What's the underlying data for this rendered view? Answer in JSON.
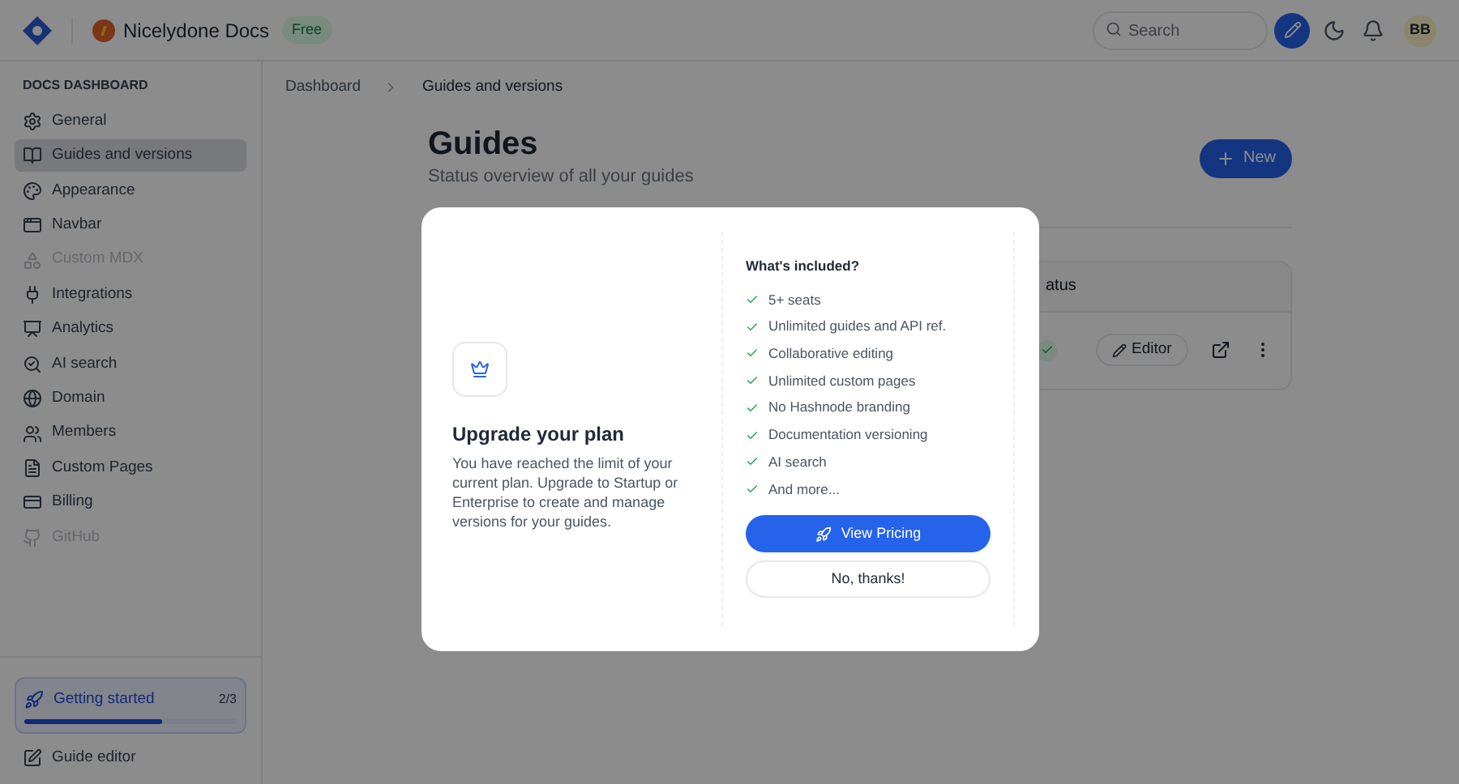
{
  "header": {
    "site_name": "Nicelydone Docs",
    "plan_badge": "Free",
    "search": {
      "placeholder": "Search"
    },
    "avatar": "BB"
  },
  "sidebar": {
    "heading": "DOCS DASHBOARD",
    "items": [
      {
        "label": "General",
        "selected": false,
        "disabled": false
      },
      {
        "label": "Guides and versions",
        "selected": true,
        "disabled": false
      },
      {
        "label": "Appearance",
        "selected": false,
        "disabled": false
      },
      {
        "label": "Navbar",
        "selected": false,
        "disabled": false
      },
      {
        "label": "Custom MDX",
        "selected": false,
        "disabled": true
      },
      {
        "label": "Integrations",
        "selected": false,
        "disabled": false
      },
      {
        "label": "Analytics",
        "selected": false,
        "disabled": false
      },
      {
        "label": "AI search",
        "selected": false,
        "disabled": false
      },
      {
        "label": "Domain",
        "selected": false,
        "disabled": false
      },
      {
        "label": "Members",
        "selected": false,
        "disabled": false
      },
      {
        "label": "Custom Pages",
        "selected": false,
        "disabled": false
      },
      {
        "label": "Billing",
        "selected": false,
        "disabled": false
      },
      {
        "label": "GitHub",
        "selected": false,
        "disabled": true
      }
    ],
    "getting_started": {
      "label": "Getting started",
      "count": "2/3",
      "level": 0.65
    },
    "footer_item": "Guide editor"
  },
  "breadcrumb": [
    "Dashboard",
    "Guides and versions"
  ],
  "page": {
    "title": "Guides",
    "subtitle": "Status overview of all your guides",
    "new_button": "New"
  },
  "table": {
    "column_header": "atus",
    "row": {
      "editor_button": "Editor"
    }
  },
  "modal": {
    "title": "Upgrade your plan",
    "body": "You have reached the limit of your current plan. Upgrade to Startup or Enterprise to create and manage versions for your guides.",
    "features_heading": "What's included?",
    "features": [
      "5+ seats",
      "Unlimited guides and API ref.",
      "Collaborative editing",
      "Unlimited custom pages",
      "No Hashnode branding",
      "Documentation versioning",
      "AI search",
      "And more..."
    ],
    "primary_button": "View Pricing",
    "secondary_button": "No, thanks!"
  }
}
